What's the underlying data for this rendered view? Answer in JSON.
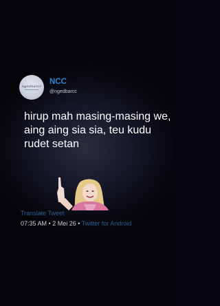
{
  "tweet": {
    "display_name": "NCC",
    "handle": "@ngedbarcc",
    "avatar_text": "ngedbarcc",
    "text": "hirup mah masing-masing we, aing aing sia sia, teu kudu rudet setan",
    "translate_label": "Translate Tweet",
    "time": "07:35 AM",
    "separator": " • ",
    "date": "2 Mei 26",
    "client": "Twitter for Android"
  },
  "colors": {
    "name": "#2b84d6",
    "link": "#2d5e92",
    "text": "#ffffff",
    "background": "#08080f"
  }
}
